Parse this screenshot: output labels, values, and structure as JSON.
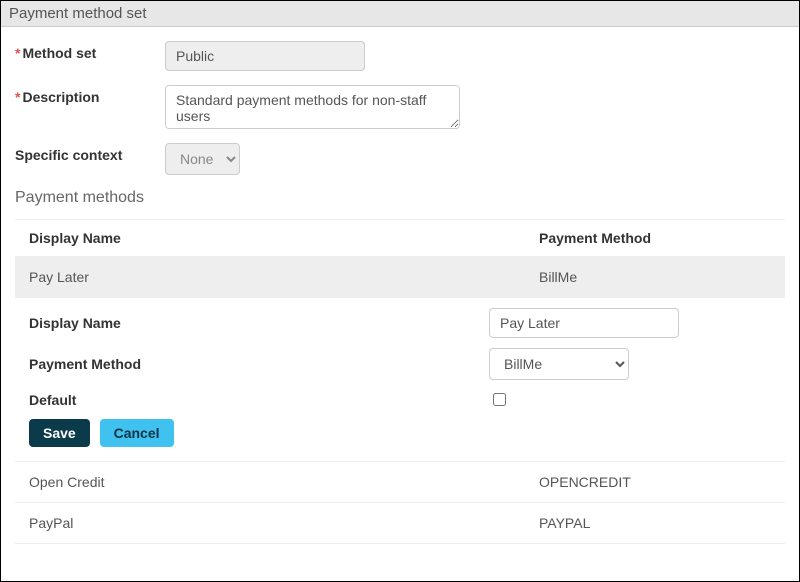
{
  "panel": {
    "title": "Payment method set"
  },
  "form": {
    "method_set": {
      "label": "Method set",
      "value": "Public",
      "required": true
    },
    "description": {
      "label": "Description",
      "value": "Standard payment methods for non-staff users",
      "required": true
    },
    "specific_context": {
      "label": "Specific context",
      "selected": "None",
      "required": false
    }
  },
  "methods_section": {
    "heading": "Payment methods"
  },
  "table": {
    "headers": {
      "display_name": "Display Name",
      "payment_method": "Payment Method"
    },
    "rows": [
      {
        "display_name": "Pay Later",
        "payment_method": "BillMe",
        "highlight": true
      },
      {
        "display_name": "Open Credit",
        "payment_method": "OPENCREDIT",
        "highlight": false
      },
      {
        "display_name": "PayPal",
        "payment_method": "PAYPAL",
        "highlight": false
      }
    ]
  },
  "edit": {
    "display_name": {
      "label": "Display Name",
      "value": "Pay Later"
    },
    "payment_method": {
      "label": "Payment Method",
      "selected": "BillMe"
    },
    "default": {
      "label": "Default",
      "checked": false
    },
    "save_label": "Save",
    "cancel_label": "Cancel"
  }
}
